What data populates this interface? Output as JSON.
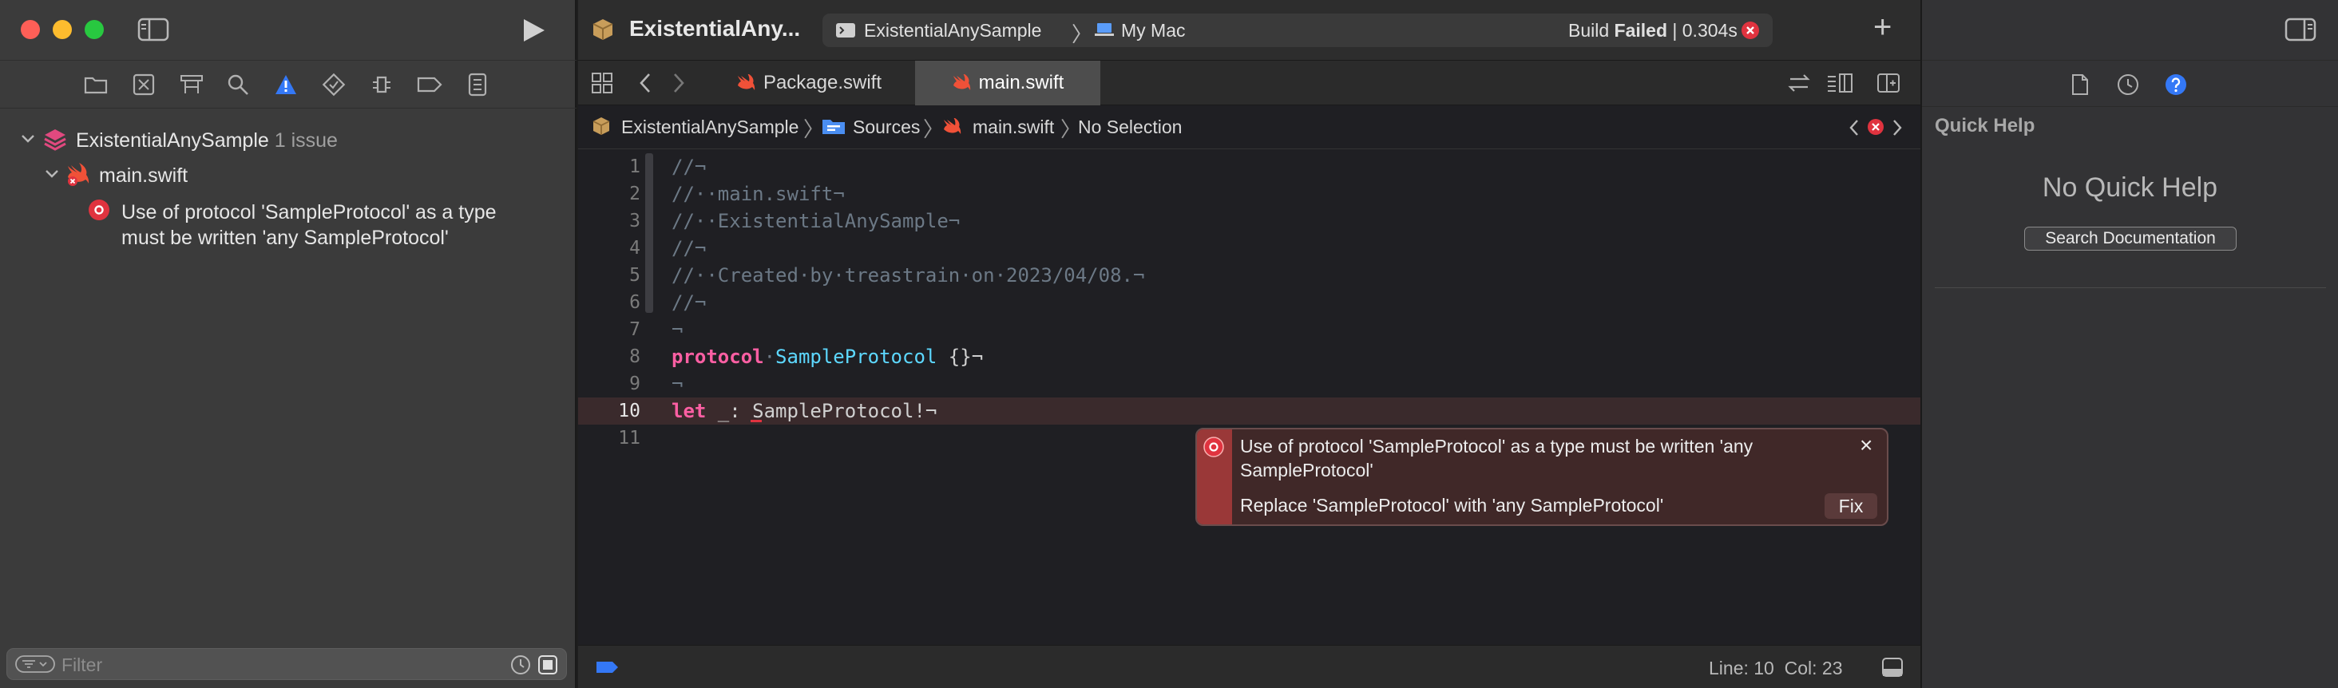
{
  "navigator": {
    "project_name": "ExistentialAnySample",
    "issue_count": "1 issue",
    "file_name": "main.swift",
    "issue_text_line1": "Use of protocol 'SampleProtocol' as a type",
    "issue_text_line2": "must be written 'any SampleProtocol'",
    "filter_placeholder": "Filter"
  },
  "toolbar": {
    "project_title": "ExistentialAny...",
    "scheme": "ExistentialAnySample",
    "destination": "My Mac",
    "build_prefix": "Build ",
    "build_status": "Failed",
    "build_time": " | 0.304s",
    "add_label": "+"
  },
  "tabs": [
    {
      "label": "Package.swift"
    },
    {
      "label": "main.swift"
    }
  ],
  "jumpbar": {
    "project": "ExistentialAnySample",
    "folder": "Sources",
    "file": "main.swift",
    "selection": "No Selection"
  },
  "editor": {
    "line_numbers": [
      "1",
      "2",
      "3",
      "4",
      "5",
      "6",
      "7",
      "8",
      "9",
      "10",
      "11"
    ],
    "lines": [
      "//¬",
      "//··main.swift¬",
      "//··ExistentialAnySample¬",
      "//¬",
      "//··Created·by·treastrain·on·2023/04/08.¬",
      "//¬",
      "¬",
      "protocol",
      "¬",
      "let",
      ""
    ],
    "line8_name": "SampleProtocol",
    "line8_rest": " {}¬",
    "line10_rest": " _: SampleProtocol!¬",
    "dot": "·"
  },
  "error_popup": {
    "message_line1": "Use of protocol 'SampleProtocol' as a type must be written 'any",
    "message_line2": "SampleProtocol'",
    "fixit": "Replace 'SampleProtocol' with 'any SampleProtocol'",
    "fix_button": "Fix",
    "close": "×"
  },
  "statusbar": {
    "position": "Line: 10  Col: 23"
  },
  "inspector": {
    "title": "Quick Help",
    "empty": "No Quick Help",
    "search_button": "Search Documentation"
  },
  "colors": {
    "error": "#e0333f",
    "accent": "#3478f6",
    "keyword": "#fc5fa3",
    "type": "#5dd8ff",
    "comment": "#6c7986"
  }
}
